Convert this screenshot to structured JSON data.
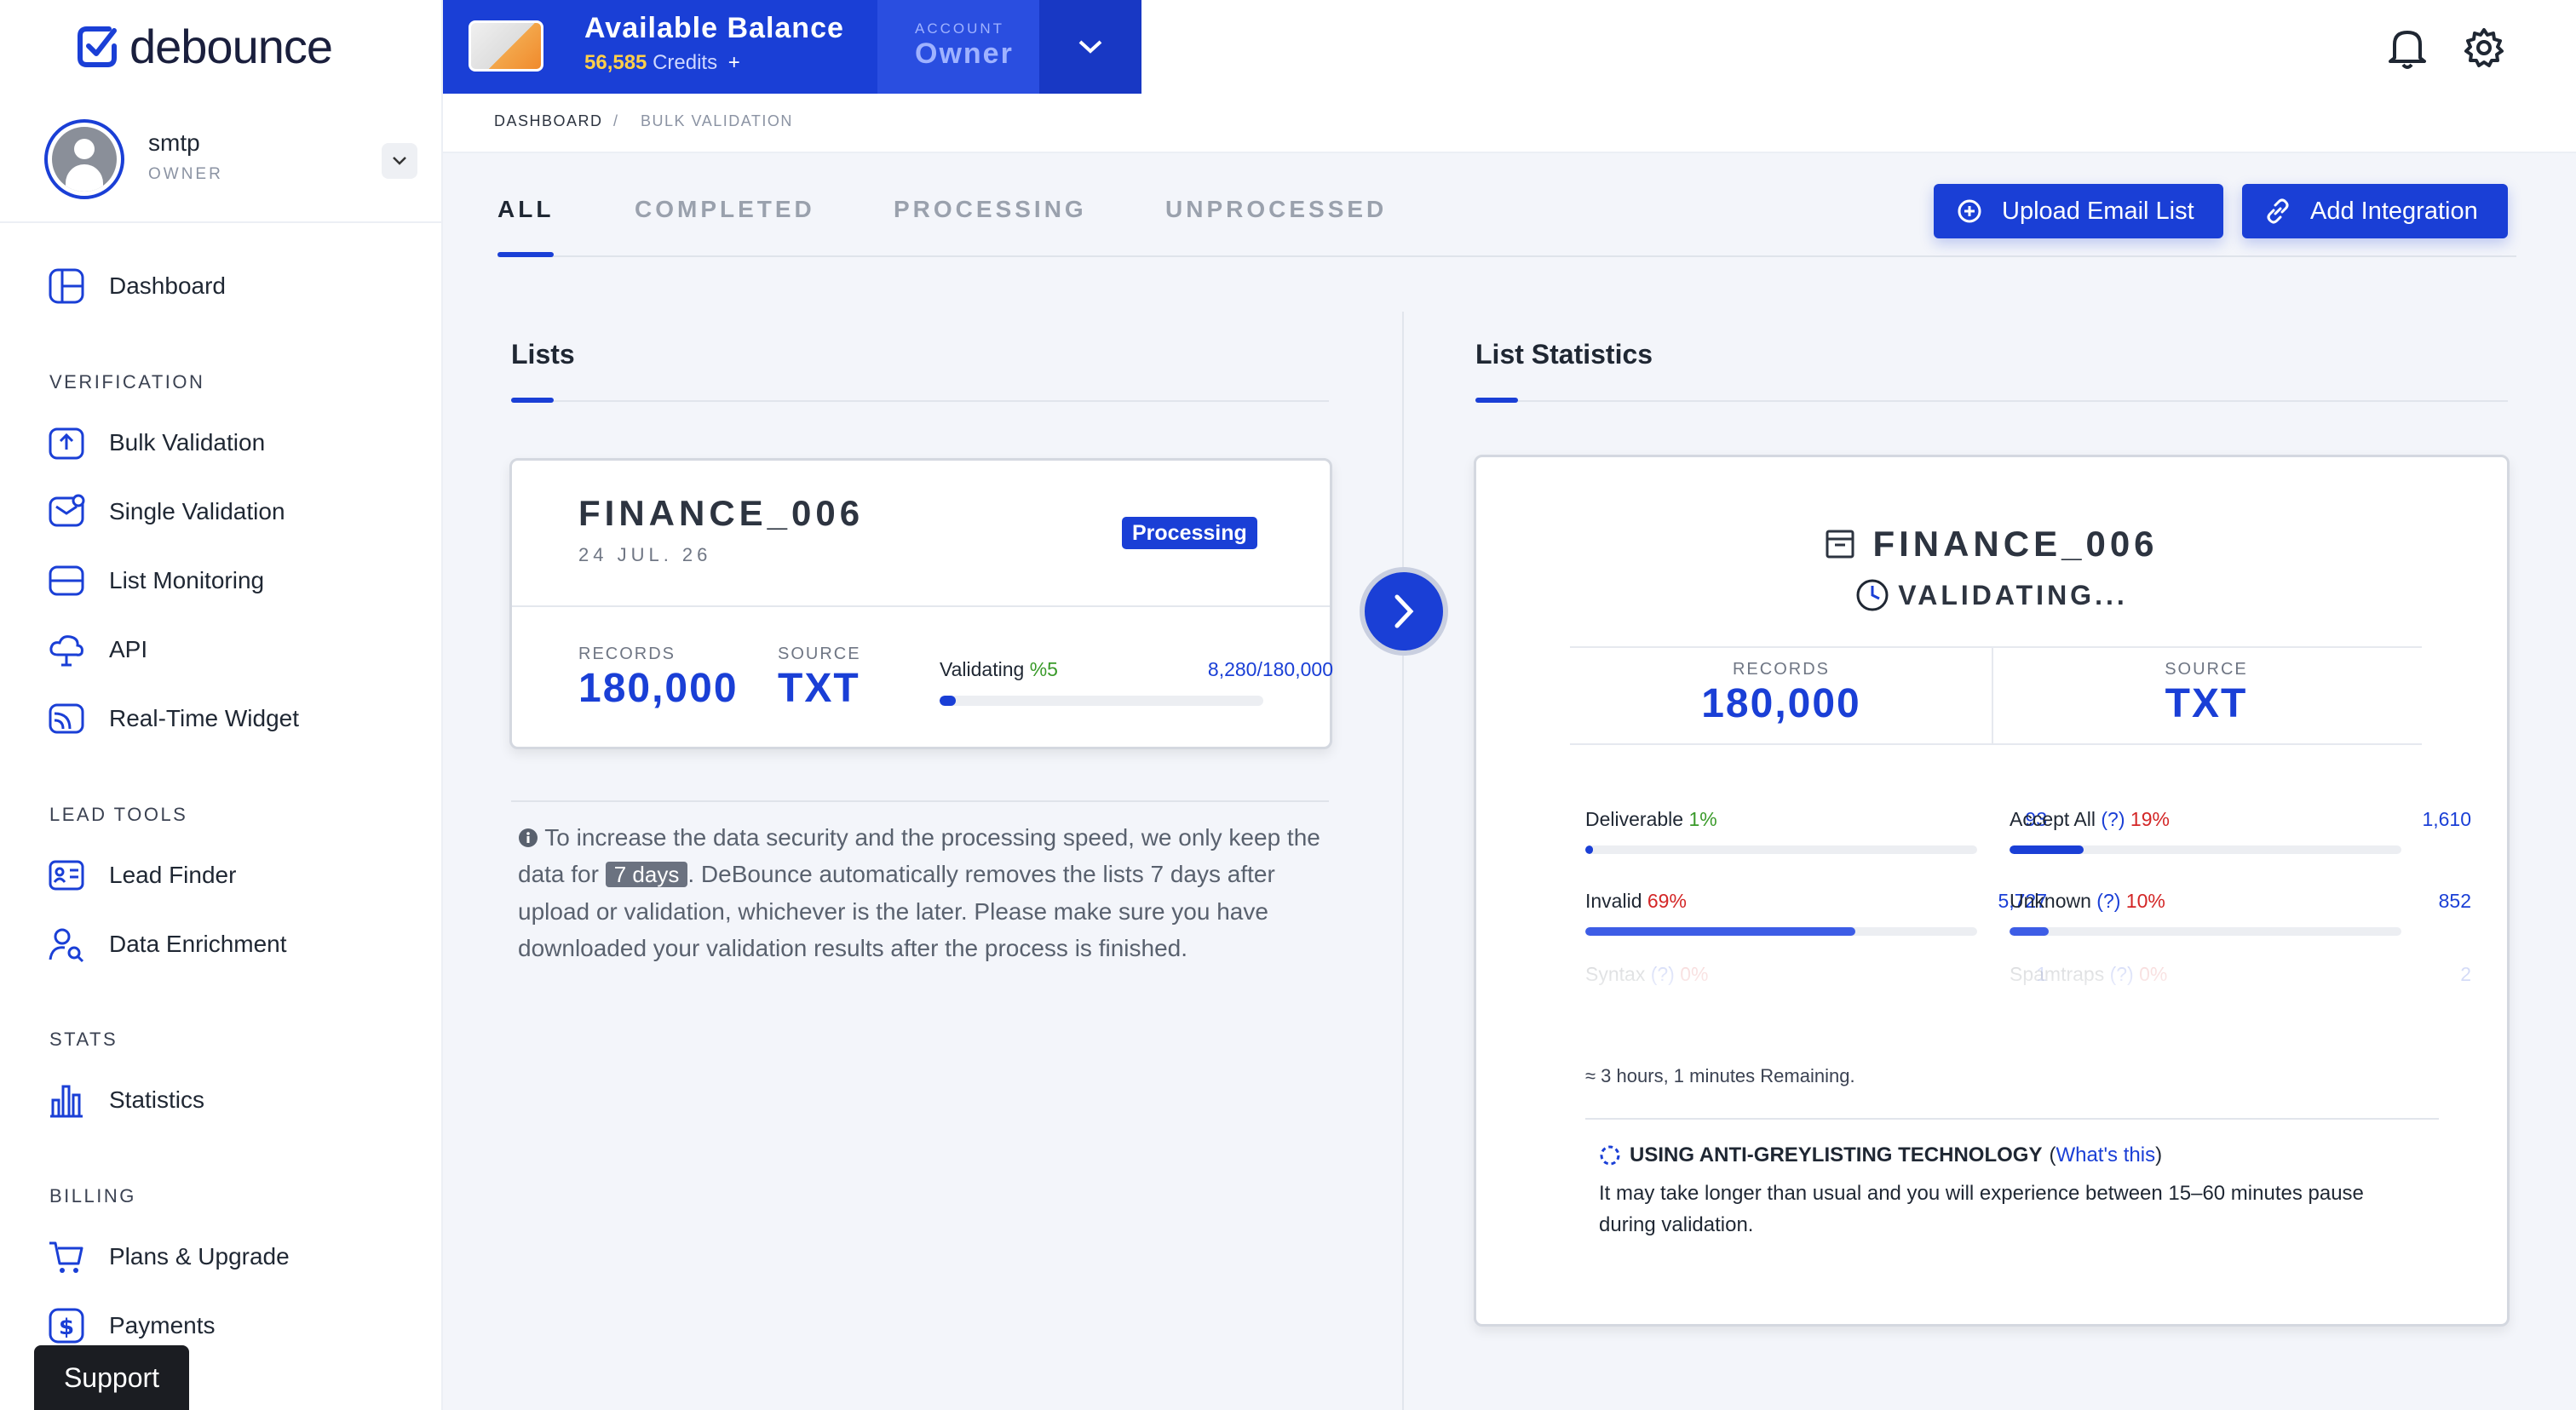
{
  "app": {
    "logo_text": "debounce"
  },
  "user": {
    "name": "smtp",
    "role": "OWNER"
  },
  "sidebar": {
    "dashboard": "Dashboard",
    "sections": {
      "verification": "VERIFICATION",
      "lead_tools": "LEAD TOOLS",
      "stats": "STATS",
      "billing": "BILLING"
    },
    "items": {
      "bulk": "Bulk Validation",
      "single": "Single Validation",
      "monitoring": "List Monitoring",
      "api": "API",
      "widget": "Real-Time Widget",
      "lead_finder": "Lead Finder",
      "enrichment": "Data Enrichment",
      "statistics": "Statistics",
      "plans": "Plans & Upgrade",
      "payments": "Payments"
    },
    "support": "Support"
  },
  "balance": {
    "title": "Available Balance",
    "credits": "56,585",
    "credits_label": "Credits",
    "plus": "+",
    "account_label": "ACCOUNT",
    "account_value": "Owner"
  },
  "breadcrumb": {
    "root": "DASHBOARD",
    "sep": "/",
    "current": "BULK VALIDATION"
  },
  "tabs": [
    "ALL",
    "COMPLETED",
    "PROCESSING",
    "UNPROCESSED"
  ],
  "actions": {
    "upload": "Upload Email List",
    "integration": "Add Integration"
  },
  "lists_panel": {
    "title": "Lists",
    "card": {
      "name": "FINANCE_006",
      "date": "24 JUL. 26",
      "status": "Processing",
      "records_label": "RECORDS",
      "records": "180,000",
      "source_label": "SOURCE",
      "source": "TXT",
      "validating_label": "Validating",
      "validating_pct": "%5",
      "progress_text": "8,280/180,000",
      "progress": 0.05
    },
    "note": {
      "before": "To increase the data security and the processing speed, we only keep the data for",
      "days": "7 days",
      "after": ". DeBounce automatically removes the lists 7 days after upload or validation, whichever is the later. Please make sure you have downloaded your validation results after the process is finished."
    }
  },
  "stats_panel": {
    "title": "List Statistics",
    "name": "FINANCE_006",
    "status": "VALIDATING...",
    "records_label": "RECORDS",
    "records": "180,000",
    "source_label": "SOURCE",
    "source": "TXT",
    "stats": {
      "deliverable": {
        "label": "Deliverable",
        "pct": "1%",
        "count": "93",
        "fraction": 0.01
      },
      "accept_all": {
        "label": "Accept All",
        "q": "(?)",
        "pct": "19%",
        "count": "1,610",
        "fraction": 0.19
      },
      "invalid": {
        "label": "Invalid",
        "pct": "69%",
        "count": "5,727",
        "fraction": 0.69
      },
      "unknown": {
        "label": "Unknown",
        "q": "(?)",
        "pct": "10%",
        "count": "852",
        "fraction": 0.1
      },
      "syntax": {
        "label": "Syntax",
        "q": "(?)",
        "pct": "0%",
        "count": "1"
      },
      "spamtraps": {
        "label": "Spamtraps",
        "q": "(?)",
        "pct": "0%",
        "count": "2"
      }
    },
    "remaining": "≈ 3 hours, 1 minutes Remaining.",
    "greylist_title": "USING ANTI-GREYLISTING TECHNOLOGY",
    "greylist_paren_open": "(",
    "greylist_link": "What's this",
    "greylist_paren_close": ")",
    "greylist_desc": "It may take longer than usual and you will experience between 15–60 minutes pause during validation."
  },
  "colors": {
    "accent": "#1a3fd6",
    "green": "#3a9a2a",
    "red": "#d32626"
  }
}
